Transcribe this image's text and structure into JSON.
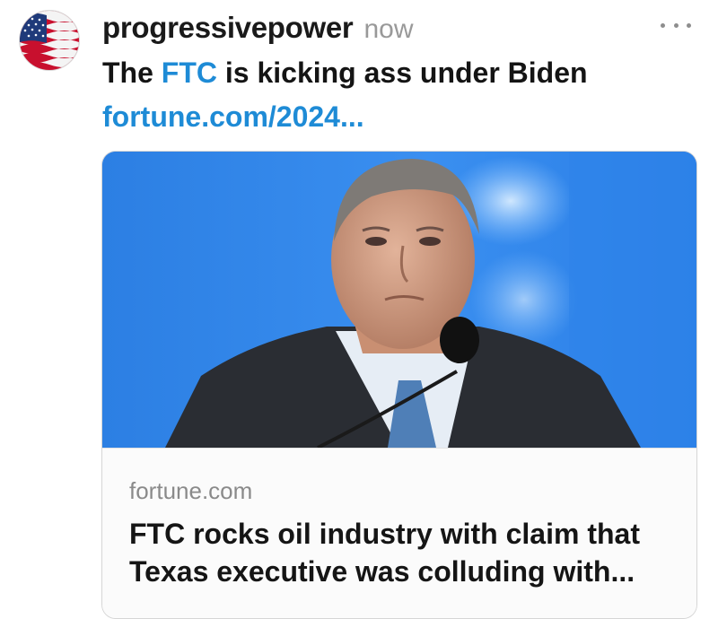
{
  "post": {
    "username": "progressivepower",
    "timestamp": "now",
    "text_before": "The ",
    "hashtag": "FTC",
    "text_after": " is kicking ass under Biden",
    "link_text": "fortune.com/2024..."
  },
  "link_card": {
    "domain": "fortune.com",
    "title_line1": "FTC rocks oil industry with claim that",
    "title_line2": "Texas executive was colluding with..."
  },
  "icons": {
    "avatar": "american-flag",
    "more": "ellipsis-horizontal"
  },
  "colors": {
    "link": "#1e8bd6",
    "card_image_background": "#2f86ea",
    "timestamp": "#999999",
    "card_domain": "#8a8a8a"
  }
}
